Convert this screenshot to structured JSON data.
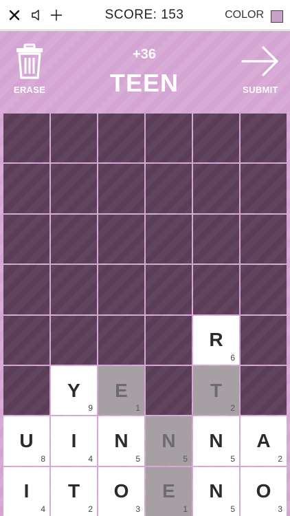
{
  "toolbar": {
    "score_label": "SCORE: 153",
    "color_label": "COLOR",
    "color_swatch": "#c9a0c7"
  },
  "hud": {
    "erase_label": "ERASE",
    "submit_label": "SUBMIT",
    "bonus": "+36",
    "word": "TEEN"
  },
  "colors": {
    "field": "#d4a4d2",
    "empty_cell": "#5b3d57",
    "tile": "#ffffff",
    "selected_tile": "#a6a0a5"
  },
  "grid": {
    "cols": 6,
    "rows": 8,
    "tiles": [
      {
        "row": 5,
        "col": 5,
        "letter": "R",
        "points": "6",
        "selected": false
      },
      {
        "row": 6,
        "col": 2,
        "letter": "Y",
        "points": "9",
        "selected": false
      },
      {
        "row": 6,
        "col": 3,
        "letter": "E",
        "points": "1",
        "selected": true
      },
      {
        "row": 6,
        "col": 5,
        "letter": "T",
        "points": "2",
        "selected": true
      },
      {
        "row": 7,
        "col": 1,
        "letter": "U",
        "points": "8",
        "selected": false
      },
      {
        "row": 7,
        "col": 2,
        "letter": "I",
        "points": "4",
        "selected": false
      },
      {
        "row": 7,
        "col": 3,
        "letter": "N",
        "points": "5",
        "selected": false
      },
      {
        "row": 7,
        "col": 4,
        "letter": "N",
        "points": "5",
        "selected": true
      },
      {
        "row": 7,
        "col": 5,
        "letter": "N",
        "points": "5",
        "selected": false
      },
      {
        "row": 7,
        "col": 6,
        "letter": "A",
        "points": "2",
        "selected": false
      },
      {
        "row": 8,
        "col": 1,
        "letter": "I",
        "points": "4",
        "selected": false
      },
      {
        "row": 8,
        "col": 2,
        "letter": "T",
        "points": "2",
        "selected": false
      },
      {
        "row": 8,
        "col": 3,
        "letter": "O",
        "points": "3",
        "selected": false
      },
      {
        "row": 8,
        "col": 4,
        "letter": "E",
        "points": "1",
        "selected": true
      },
      {
        "row": 8,
        "col": 5,
        "letter": "N",
        "points": "5",
        "selected": false
      },
      {
        "row": 8,
        "col": 6,
        "letter": "O",
        "points": "3",
        "selected": false
      }
    ]
  }
}
